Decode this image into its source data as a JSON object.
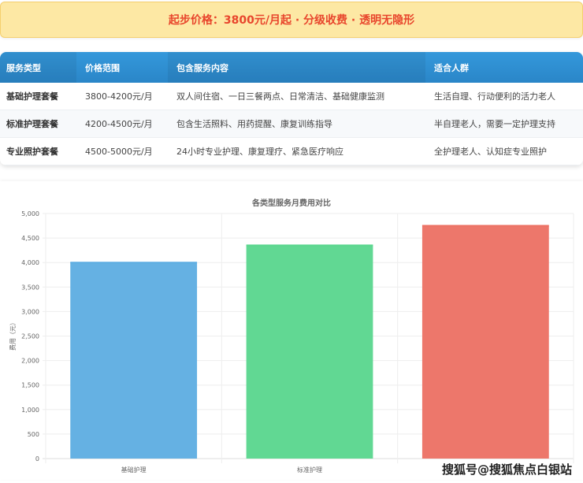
{
  "banner": {
    "text": "起步价格：3800元/月起 · 分级收费 · 透明无隐形"
  },
  "table": {
    "headers": [
      "服务类型",
      "价格范围",
      "包含服务内容",
      "适合人群"
    ],
    "rows": [
      [
        "基础护理套餐",
        "3800-4200元/月",
        "双人间住宿、一日三餐两点、日常清洁、基础健康监测",
        "生活自理、行动便利的活力老人"
      ],
      [
        "标准护理套餐",
        "4200-4500元/月",
        "包含生活照料、用药提醒、康复训练指导",
        "半自理老人，需要一定护理支持"
      ],
      [
        "专业照护套餐",
        "4500-5000元/月",
        "24小时专业护理、康复理疗、紧急医疗响应",
        "全护理老人、认知症专业照护"
      ]
    ]
  },
  "chart_data": {
    "type": "bar",
    "title": "各类型服务月费用对比",
    "ylabel": "费用（元）",
    "xlabel": "",
    "categories": [
      "基础护理",
      "标准护理",
      ""
    ],
    "values": [
      4000,
      4350,
      4750
    ],
    "colors": [
      "#5dade2",
      "#58d68d",
      "#ec7063"
    ],
    "ylim": [
      0,
      5000
    ],
    "yticks": [
      "0",
      "500",
      "1,000",
      "1,500",
      "2,000",
      "2,500",
      "3,000",
      "3,500",
      "4,000",
      "4,500",
      "5,000"
    ],
    "grid": true
  },
  "watermark": "搜狐号@搜狐焦点白银站"
}
